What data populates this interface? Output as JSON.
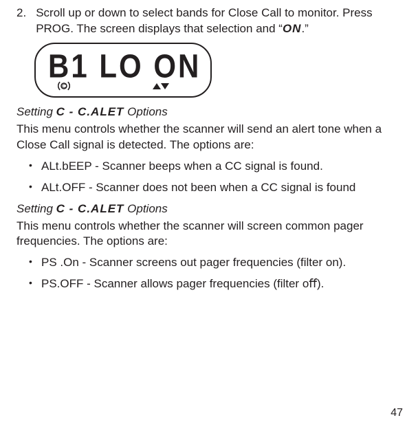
{
  "step": {
    "number": "2.",
    "text_before": "Scroll up or down to select bands for Close Call to monitor. Press PROG. The screen displays that selection and “",
    "lcd_word": "ON",
    "text_after": ".”"
  },
  "lcd": {
    "display": "B1 LO ON"
  },
  "section1": {
    "heading_prefix": "Setting ",
    "heading_code": "C - C.ALET",
    "heading_suffix": " Options",
    "description": "This menu controls whether the scanner will send an alert tone when a Close Call signal is detected. The options are:",
    "options": [
      "ALt.bEEP - Scanner beeps when a CC signal is found.",
      "ALt.OFF - Scanner does not been when a CC signal is found"
    ]
  },
  "section2": {
    "heading_prefix": "Setting ",
    "heading_code": "C - C.ALET",
    "heading_suffix": " Options",
    "description": "This menu controls whether the scanner will screen common pager frequencies. The options are:",
    "options": [
      "PS .On - Scanner screens out pager frequencies (ﬁlter on).",
      "PS.OFF - Scanner allows pager frequencies (ﬁlter oﬀ)."
    ]
  },
  "page_number": "47"
}
